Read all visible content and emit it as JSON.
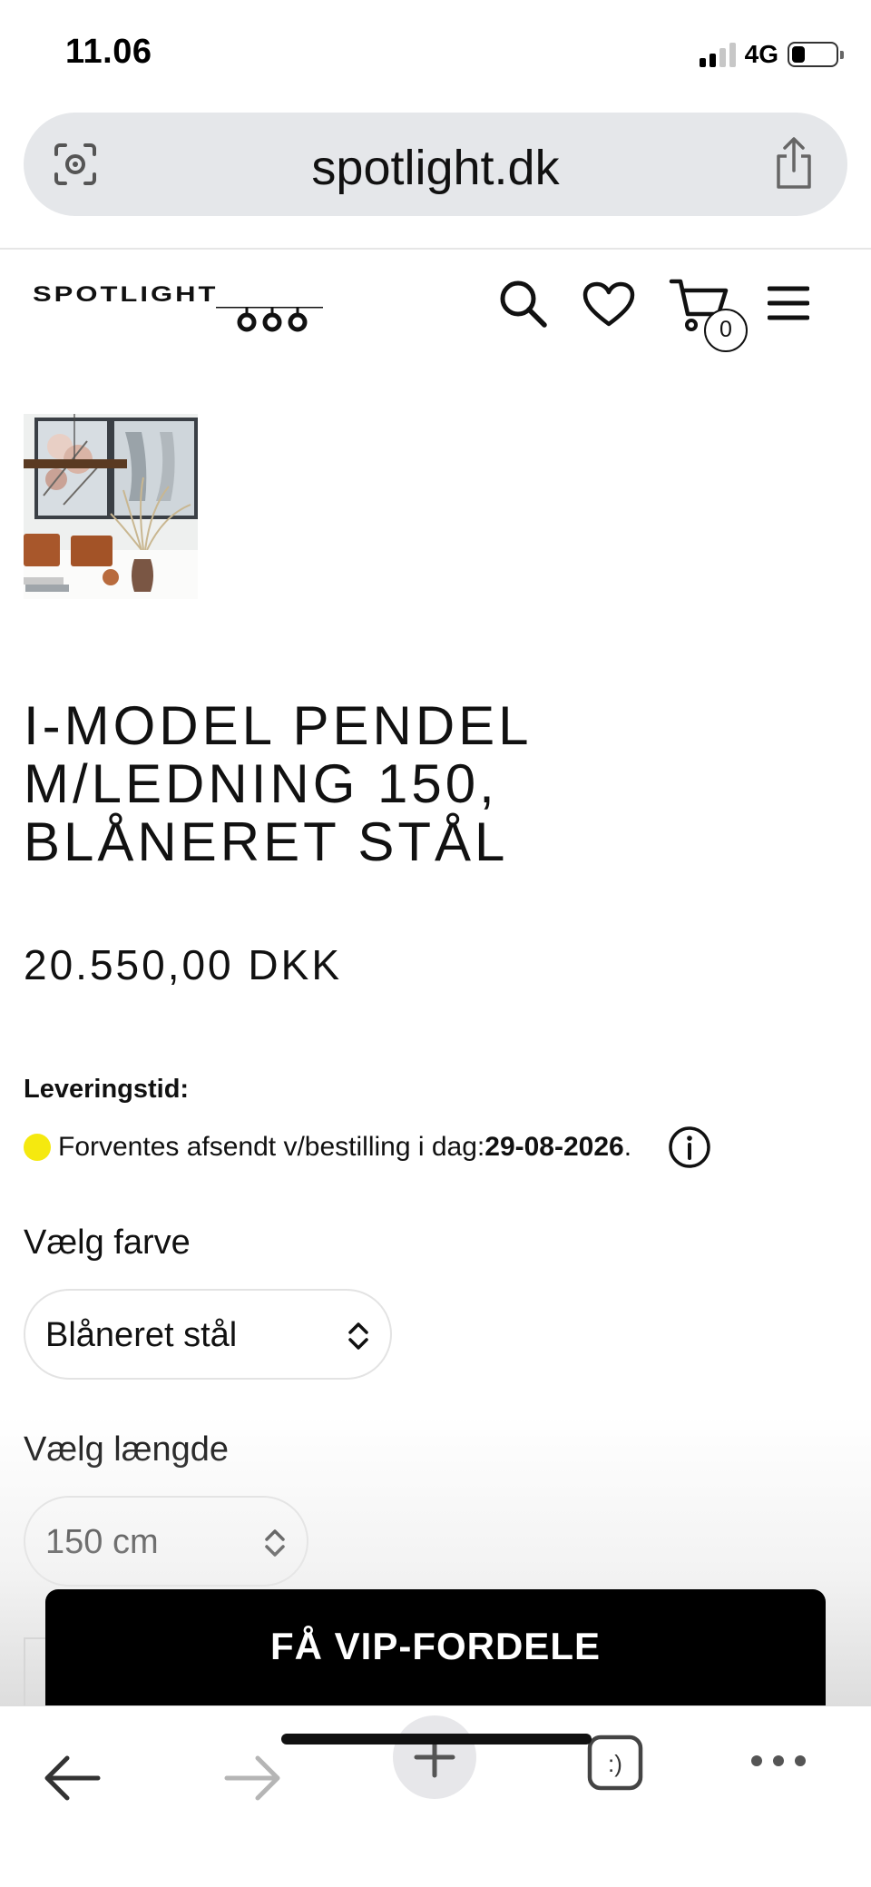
{
  "status_bar": {
    "time": "11.06",
    "network": "4G",
    "battery_level": 0.3,
    "signal_bars": 2
  },
  "browser": {
    "url": "spotlight.dk",
    "icons": {
      "left": "visual-search-icon",
      "right": "share-icon"
    }
  },
  "site_header": {
    "logo_text": "SPOTLIGHT",
    "icons": [
      "search-icon",
      "heart-icon",
      "cart-icon",
      "menu-icon"
    ],
    "cart_count": "0"
  },
  "product": {
    "title_lines": [
      "I-MODEL PENDEL",
      "M/LEDNING 150,",
      "BLÅNERET STÅL"
    ],
    "price": "20.550,00 DKK",
    "delivery": {
      "label": "Leveringstid:",
      "text": "Forventes afsendt v/bestilling i dag: ",
      "date": "29-08-2026",
      "suffix": ".",
      "status_color": "#f5e90f"
    },
    "options": {
      "color": {
        "label": "Vælg farve",
        "selected": "Blåneret stål"
      },
      "length": {
        "label": "Vælg længde",
        "selected": "150 cm"
      }
    }
  },
  "vip_banner": {
    "label": "FÅ VIP-FORDELE"
  },
  "toolbar": {
    "items": [
      "back-icon",
      "forward-icon",
      "plus-icon",
      "tabs-icon",
      "more-icon"
    ],
    "tabs_glyph": ":)"
  }
}
